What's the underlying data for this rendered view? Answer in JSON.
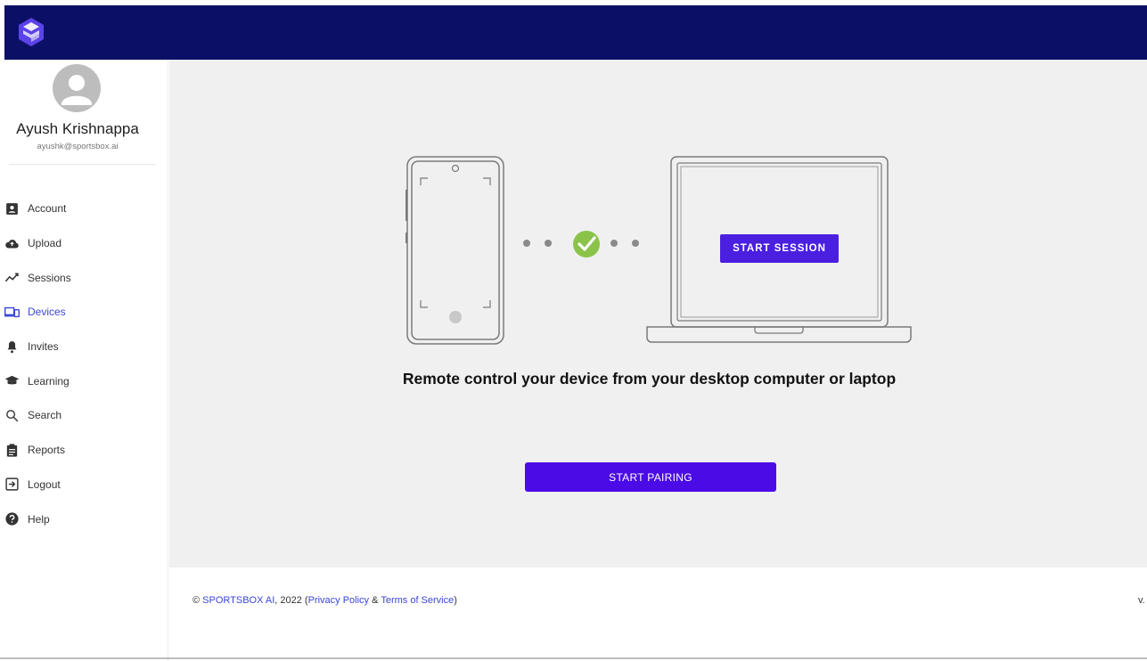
{
  "user": {
    "name": "Ayush Krishnappa",
    "email": "ayushk@sportsbox.ai"
  },
  "nav": [
    {
      "label": "Account",
      "icon": "account-box-icon",
      "active": false
    },
    {
      "label": "Upload",
      "icon": "cloud-upload-icon",
      "active": false
    },
    {
      "label": "Sessions",
      "icon": "trending-line-icon",
      "active": false
    },
    {
      "label": "Devices",
      "icon": "devices-icon",
      "active": true
    },
    {
      "label": "Invites",
      "icon": "bell-icon",
      "active": false
    },
    {
      "label": "Learning",
      "icon": "graduation-cap-icon",
      "active": false
    },
    {
      "label": "Search",
      "icon": "search-icon",
      "active": false
    },
    {
      "label": "Reports",
      "icon": "clipboard-icon",
      "active": false
    },
    {
      "label": "Logout",
      "icon": "logout-icon",
      "active": false
    },
    {
      "label": "Help",
      "icon": "help-icon",
      "active": false
    }
  ],
  "main": {
    "start_session_label": "START SESSION",
    "headline": "Remote control your device from your desktop computer or laptop",
    "start_pairing_label": "START PAIRING"
  },
  "footer": {
    "copyright_prefix": "© ",
    "company_link": "SPORTSBOX AI",
    "year_text": ", 2022 (",
    "privacy_link": "Privacy Policy",
    "amp": " & ",
    "terms_link": "Terms of Service",
    "close_paren": ")",
    "version": "v."
  },
  "colors": {
    "topbar": "#0b1066",
    "accent": "#4b1fe0",
    "active_nav": "#3b46d6",
    "check": "#8bc34a"
  }
}
